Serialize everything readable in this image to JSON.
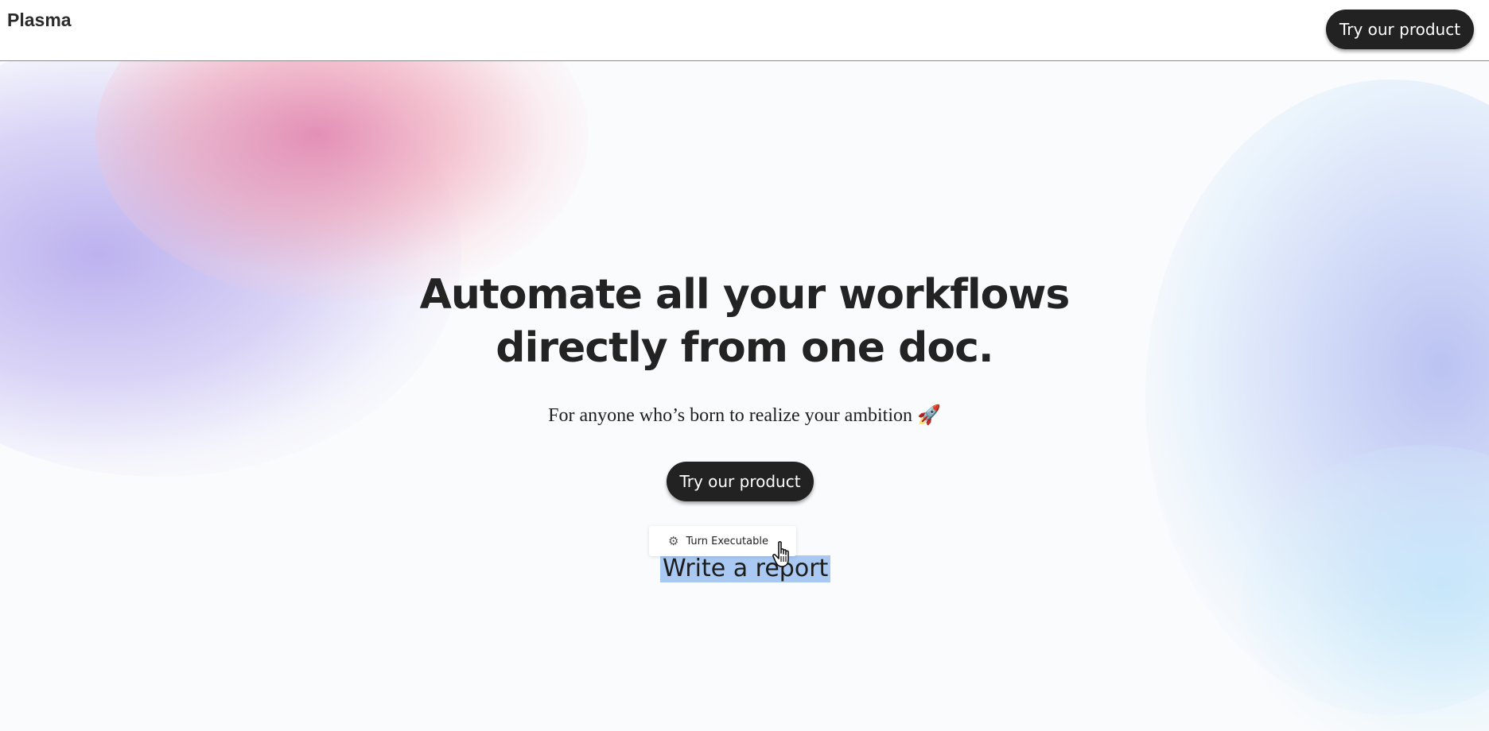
{
  "header": {
    "brand": "Plasma",
    "cta_label": "Try our product"
  },
  "hero": {
    "title_line1": "Automate all your workflows",
    "title_line2": "directly from one doc.",
    "subtitle": "For anyone who’s born to realize your ambition 🚀",
    "cta_label": "Try our product"
  },
  "editor": {
    "tooltip_label": "Turn Executable",
    "tooltip_icon": "gear-icon",
    "selected_text": "Write a report"
  },
  "colors": {
    "button_bg": "#222222",
    "button_text": "#ffffff",
    "selection_bg": "#a9c9f2",
    "accent_pink": "#e280aa",
    "accent_purple": "#b2a5ec",
    "accent_blue": "#b0b9f0"
  }
}
